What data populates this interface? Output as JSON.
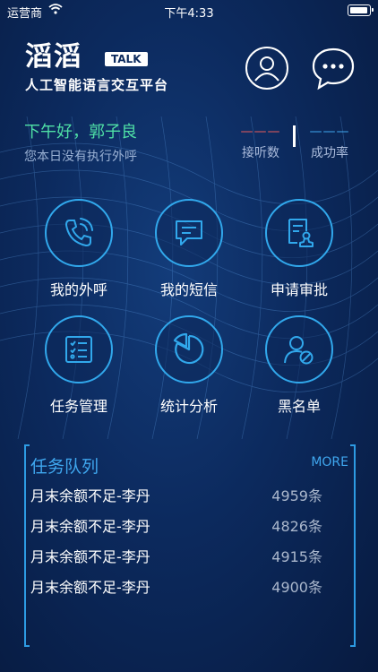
{
  "status_bar": {
    "carrier": "运营商",
    "time": "下午4:33"
  },
  "logo": {
    "main": "滔滔",
    "badge": "TALK",
    "subtitle": "人工智能语言交互平台"
  },
  "greeting": {
    "title": "下午好，郭子良",
    "subtitle": "您本日没有执行外呼"
  },
  "stats": [
    {
      "value": "———",
      "label": "接听数",
      "color": "#e95b5b"
    },
    {
      "value": "———",
      "label": "成功率",
      "color": "#3fa7ef"
    }
  ],
  "grid": [
    {
      "label": "我的外呼",
      "icon": "phone-icon"
    },
    {
      "label": "我的短信",
      "icon": "sms-icon"
    },
    {
      "label": "申请审批",
      "icon": "approval-icon"
    },
    {
      "label": "任务管理",
      "icon": "task-list-icon"
    },
    {
      "label": "统计分析",
      "icon": "pie-chart-icon"
    },
    {
      "label": "黑名单",
      "icon": "blocked-user-icon"
    }
  ],
  "queue": {
    "title": "任务队列",
    "more": "MORE",
    "rows": [
      {
        "name": "月末余额不足-李丹",
        "count": "4959条"
      },
      {
        "name": "月末余额不足-李丹",
        "count": "4826条"
      },
      {
        "name": "月末余额不足-李丹",
        "count": "4915条"
      },
      {
        "name": "月末余额不足-李丹",
        "count": "4900条"
      }
    ]
  },
  "colors": {
    "accent": "#31a8ec",
    "greeting": "#4fe0a6",
    "background": "#0c2a5e"
  }
}
